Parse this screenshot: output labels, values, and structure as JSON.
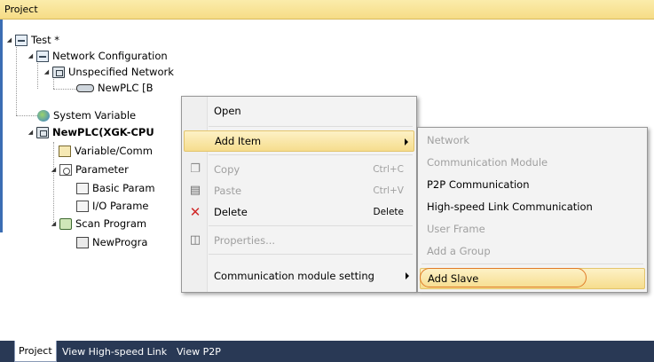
{
  "pane": {
    "title": "Project"
  },
  "tree": {
    "items": [
      {
        "label": "Test *",
        "icon": "network-icon"
      },
      {
        "label": "Network Configuration",
        "icon": "network-config-icon"
      },
      {
        "label": "Unspecified Network",
        "icon": "plc-icon"
      },
      {
        "label": "NewPLC [B",
        "icon": "link-icon"
      },
      {
        "label": "System Variable",
        "icon": "system-variable-icon"
      },
      {
        "label": "NewPLC(XGK-CPU",
        "icon": "plc-icon"
      },
      {
        "label": "Variable/Comm",
        "icon": "variable-icon"
      },
      {
        "label": "Parameter",
        "icon": "parameter-icon"
      },
      {
        "label": "Basic Param",
        "icon": "parameter-doc-icon"
      },
      {
        "label": "I/O Parame",
        "icon": "parameter-doc-icon"
      },
      {
        "label": "Scan Program",
        "icon": "scan-program-icon"
      },
      {
        "label": "NewProgra",
        "icon": "program-icon"
      }
    ]
  },
  "context_menu": {
    "items": [
      {
        "label": "Open",
        "shortcut": "",
        "enabled": true
      },
      {
        "label": "Add Item",
        "shortcut": "",
        "enabled": true
      },
      {
        "label": "Copy",
        "shortcut": "Ctrl+C",
        "enabled": false
      },
      {
        "label": "Paste",
        "shortcut": "Ctrl+V",
        "enabled": false
      },
      {
        "label": "Delete",
        "shortcut": "Delete",
        "enabled": true
      },
      {
        "label": "Properties...",
        "shortcut": "",
        "enabled": false
      },
      {
        "label": "Communication module setting",
        "shortcut": "",
        "enabled": true
      }
    ]
  },
  "submenu": {
    "items": [
      {
        "label": "Network",
        "enabled": false
      },
      {
        "label": "Communication Module",
        "enabled": false
      },
      {
        "label": "P2P Communication",
        "enabled": true
      },
      {
        "label": "High-speed Link Communication",
        "enabled": true
      },
      {
        "label": "User Frame",
        "enabled": false
      },
      {
        "label": "Add a Group",
        "enabled": false
      },
      {
        "label": "Add Slave",
        "enabled": true
      }
    ]
  },
  "tabs": [
    {
      "label": "Project"
    },
    {
      "label": "View High-speed Link"
    },
    {
      "label": "View P2P"
    }
  ],
  "colors": {
    "highlight": "#f6dd8d",
    "tab_bar": "#293955",
    "annotation_oval": "#e07b28"
  }
}
